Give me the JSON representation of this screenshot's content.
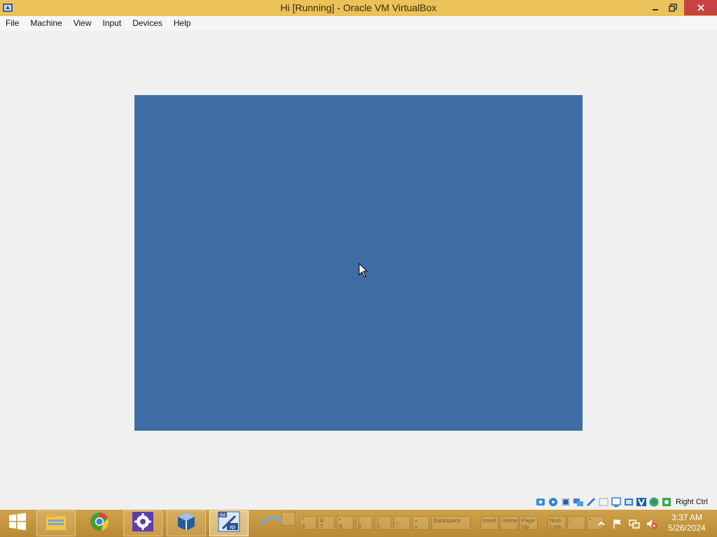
{
  "window": {
    "title": "Hi [Running] - Oracle VM VirtualBox"
  },
  "menu": {
    "items": [
      "File",
      "Machine",
      "View",
      "Input",
      "Devices",
      "Help"
    ]
  },
  "vm_screen": {
    "background": "#3e6da6"
  },
  "status_bar": {
    "icons": [
      "hard-disk-icon",
      "optical-drive-icon",
      "audio-icon",
      "network-icon",
      "usb-icon",
      "shared-folders-icon",
      "display-icon",
      "video-capture-icon",
      "mouse-integration-icon",
      "virtualization-icon",
      "globe-icon",
      "keyboard-capture-icon"
    ],
    "host_key": "Right Ctrl"
  },
  "taskbar": {
    "apps": [
      "file-explorer-icon",
      "chrome-icon",
      "settings-icon",
      "virtualbox-icon",
      "windows-xp-64-icon"
    ],
    "osk_keys": [
      {
        "id": "k1",
        "label": ""
      },
      {
        "id": "k2",
        "label": "^\n6"
      },
      {
        "id": "k3",
        "label": "&\n7"
      },
      {
        "id": "k4",
        "label": "*\n8"
      },
      {
        "id": "k5",
        "label": "(\n9"
      },
      {
        "id": "k6",
        "label": ")\n0"
      },
      {
        "id": "k7",
        "label": "_\n-"
      },
      {
        "id": "k8",
        "label": "+\n="
      },
      {
        "id": "k9",
        "label": "Backspace"
      },
      {
        "id": "k10",
        "label": "Insert"
      },
      {
        "id": "k11",
        "label": "Home"
      },
      {
        "id": "k12",
        "label": "Page\nUp"
      },
      {
        "id": "k13",
        "label": "Num\nLock"
      },
      {
        "id": "k14",
        "label": "/"
      },
      {
        "id": "k15",
        "label": "*"
      }
    ]
  },
  "clock": {
    "time": "3:37 AM",
    "date": "5/26/2024"
  }
}
